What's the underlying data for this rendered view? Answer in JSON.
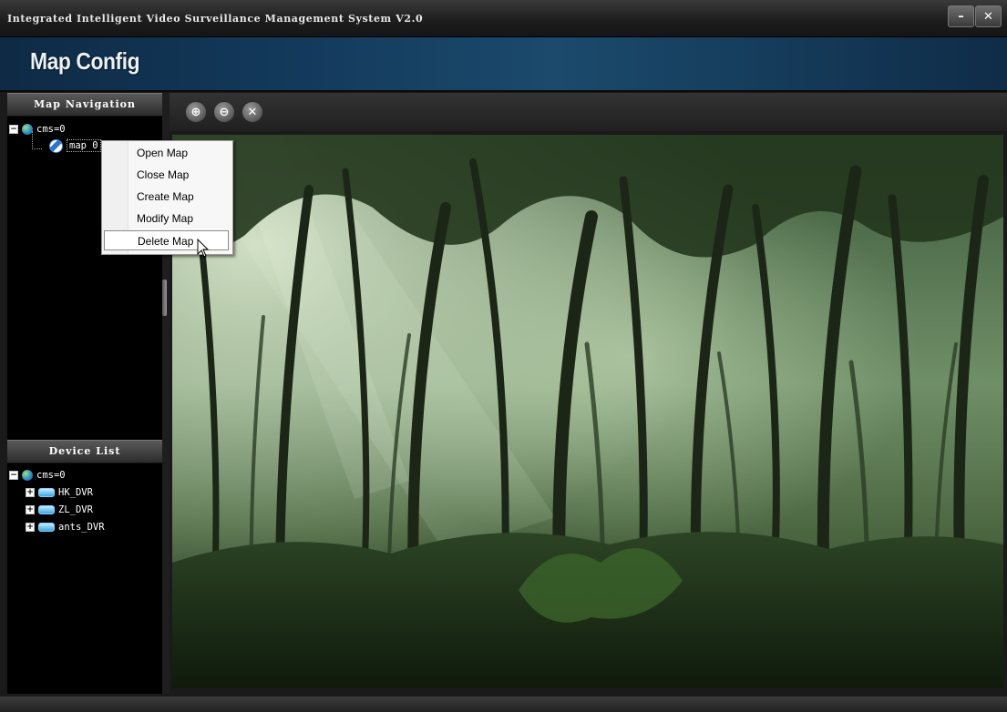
{
  "window": {
    "title": "Integrated Intelligent Video Surveillance Management System V2.0",
    "minimize_label": "–",
    "close_label": "✕"
  },
  "header": {
    "module_title": "Map Config"
  },
  "map_navigation": {
    "heading": "Map Navigation",
    "root": {
      "label": "cms=0",
      "expanded": true,
      "icon": "globe-icon"
    },
    "maps": [
      {
        "label": "map 0",
        "icon": "map-icon",
        "selected": true
      }
    ]
  },
  "device_list": {
    "heading": "Device List",
    "root": {
      "label": "cms=0",
      "expanded": true,
      "icon": "globe-icon"
    },
    "devices": [
      {
        "label": "HK_DVR",
        "icon": "dvr-icon"
      },
      {
        "label": "ZL_DVR",
        "icon": "dvr-icon"
      },
      {
        "label": "ants_DVR",
        "icon": "dvr-icon"
      }
    ]
  },
  "toolbar": {
    "buttons": [
      {
        "name": "zoom-in",
        "glyph": "⊕"
      },
      {
        "name": "zoom-out",
        "glyph": "⊖"
      },
      {
        "name": "close-map",
        "glyph": "✕"
      }
    ]
  },
  "context_menu": {
    "items": [
      {
        "label": "Open Map"
      },
      {
        "label": "Close Map"
      },
      {
        "label": "Create Map"
      },
      {
        "label": "Modify Map"
      },
      {
        "label": "Delete Map",
        "hovered": true
      }
    ]
  },
  "colors": {
    "header_blue": "#133a5c",
    "panel_bg": "#000000",
    "menu_bg": "#f7f7f7"
  }
}
